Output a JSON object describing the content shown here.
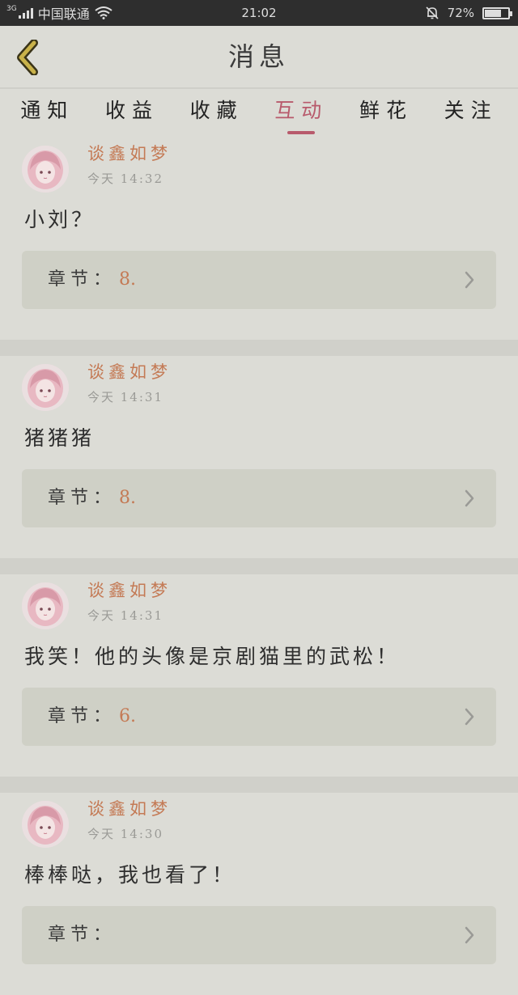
{
  "status_bar": {
    "network_type": "3G",
    "carrier": "中国联通",
    "time": "21:02",
    "battery_text": "72%",
    "battery_level": 0.72
  },
  "nav": {
    "title": "消息",
    "back_icon": "chevron-left-icon"
  },
  "tabs": [
    {
      "label": "通知",
      "active": false
    },
    {
      "label": "收益",
      "active": false
    },
    {
      "label": "收藏",
      "active": false
    },
    {
      "label": "互动",
      "active": true
    },
    {
      "label": "鲜花",
      "active": false
    },
    {
      "label": "关注",
      "active": false
    }
  ],
  "colors": {
    "accent": "#b85a6c",
    "username": "#c47a55",
    "background": "#dcdcd6"
  },
  "messages": [
    {
      "username": "谈鑫如梦",
      "time": "今天 14:32",
      "text": "小刘？",
      "chapter_label": "章节：",
      "chapter_value": "8."
    },
    {
      "username": "谈鑫如梦",
      "time": "今天 14:31",
      "text": "猪猪猪",
      "chapter_label": "章节：",
      "chapter_value": "8."
    },
    {
      "username": "谈鑫如梦",
      "time": "今天 14:31",
      "text": "我笑！他的头像是京剧猫里的武松！",
      "chapter_label": "章节：",
      "chapter_value": "6."
    },
    {
      "username": "谈鑫如梦",
      "time": "今天 14:30",
      "text": "棒棒哒，我也看了！",
      "chapter_label": "章节：",
      "chapter_value": ""
    }
  ]
}
